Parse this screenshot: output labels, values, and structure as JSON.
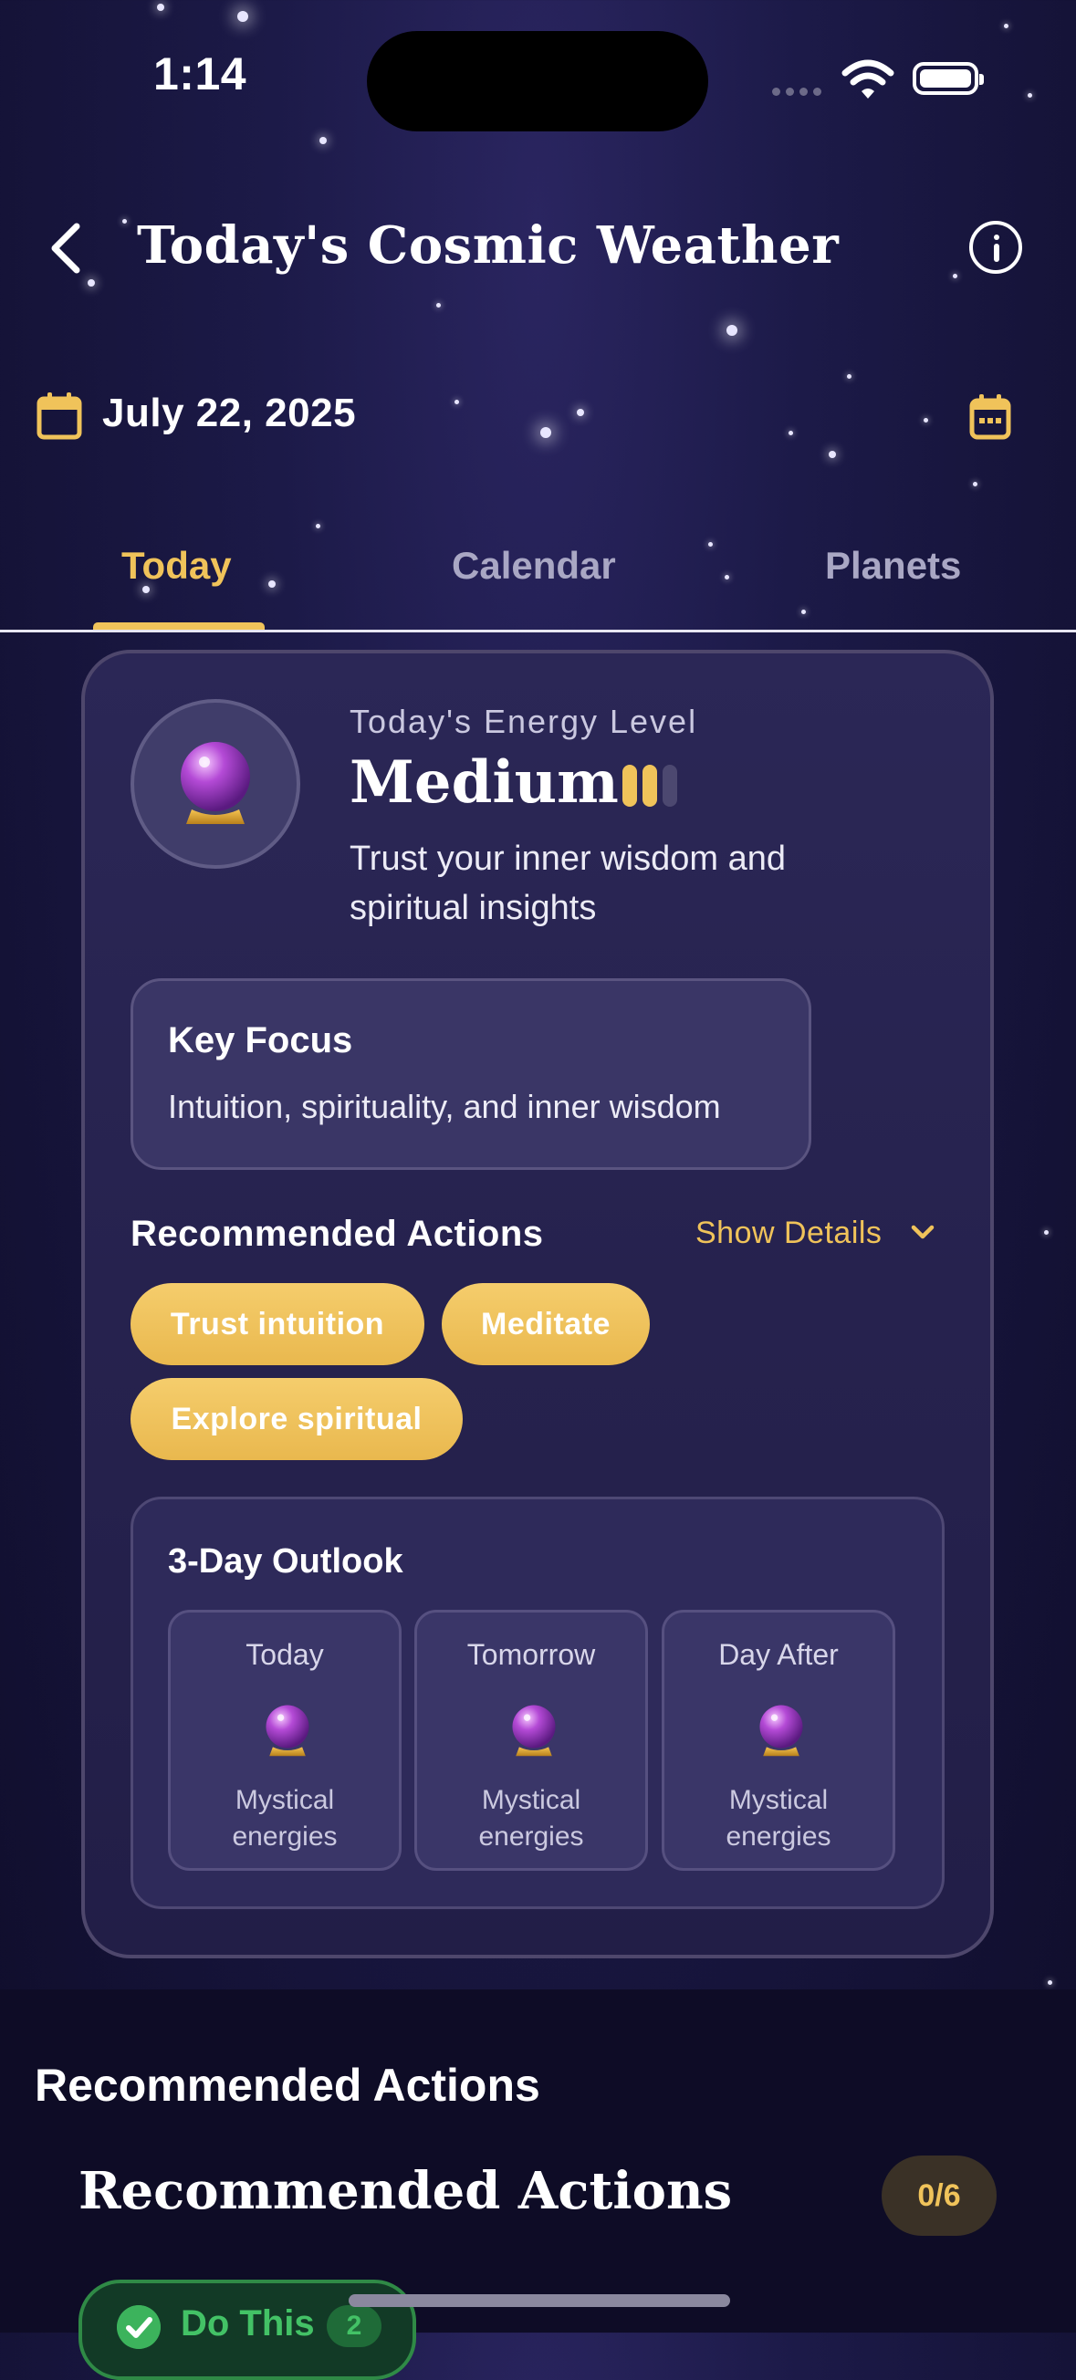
{
  "status_bar": {
    "time": "1:14"
  },
  "header": {
    "title": "Today's Cosmic Weather"
  },
  "date_row": {
    "date": "July 22, 2025"
  },
  "tabs": [
    {
      "label": "Today",
      "active": true
    },
    {
      "label": "Calendar",
      "active": false
    },
    {
      "label": "Planets",
      "active": false
    }
  ],
  "energy": {
    "label": "Today's Energy Level",
    "value": "Medium",
    "level": 2,
    "level_max": 3,
    "description": "Trust your inner wisdom and spiritual insights"
  },
  "key_focus": {
    "title": "Key Focus",
    "text": "Intuition, spirituality, and inner wisdom"
  },
  "recommended": {
    "title": "Recommended Actions",
    "toggle_label": "Show Details",
    "actions": [
      "Trust intuition",
      "Meditate",
      "Explore spiritual"
    ]
  },
  "outlook": {
    "title": "3-Day Outlook",
    "days": [
      {
        "name": "Today",
        "icon": "crystal-ball-icon",
        "desc_line1": "Mystical",
        "desc_line2": "energies"
      },
      {
        "name": "Tomorrow",
        "icon": "crystal-ball-icon",
        "desc_line1": "Mystical",
        "desc_line2": "energies"
      },
      {
        "name": "Day After",
        "icon": "crystal-ball-icon",
        "desc_line1": "Mystical",
        "desc_line2": "energies"
      }
    ]
  },
  "lower": {
    "section_title": "Recommended Actions",
    "panel_title": "Recommended Actions",
    "progress": "0/6",
    "do_this_label": "Do This",
    "do_this_count": "2"
  },
  "colors": {
    "accent": "#f0c35a",
    "background": "#1c1a48",
    "success": "#43c266"
  }
}
